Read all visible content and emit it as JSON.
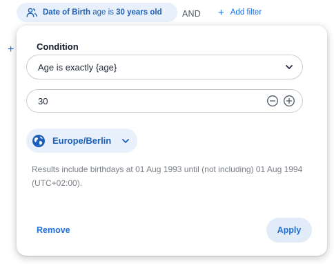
{
  "filter_chip": {
    "icon": "person-icon",
    "field": "Date of Birth",
    "connector1": "age",
    "operator": "is",
    "value": "30 years old"
  },
  "and_label": "AND",
  "add_filter": {
    "icon": "plus-icon",
    "label": "Add filter"
  },
  "background_add": "+",
  "popover": {
    "condition_label": "Condition",
    "condition_value": "Age is exactly {age}",
    "age_value": "30",
    "timezone": "Europe/Berlin",
    "info_text": "Results include birthdays at 01 Aug 1993 until (not including) 01 Aug 1994 (UTC+02:00).",
    "remove_label": "Remove",
    "apply_label": "Apply"
  },
  "colors": {
    "accent": "#1d6ed8",
    "chip_bg": "#e7f0fb",
    "muted_text": "#7a7f87",
    "border": "#c9ccd1"
  }
}
